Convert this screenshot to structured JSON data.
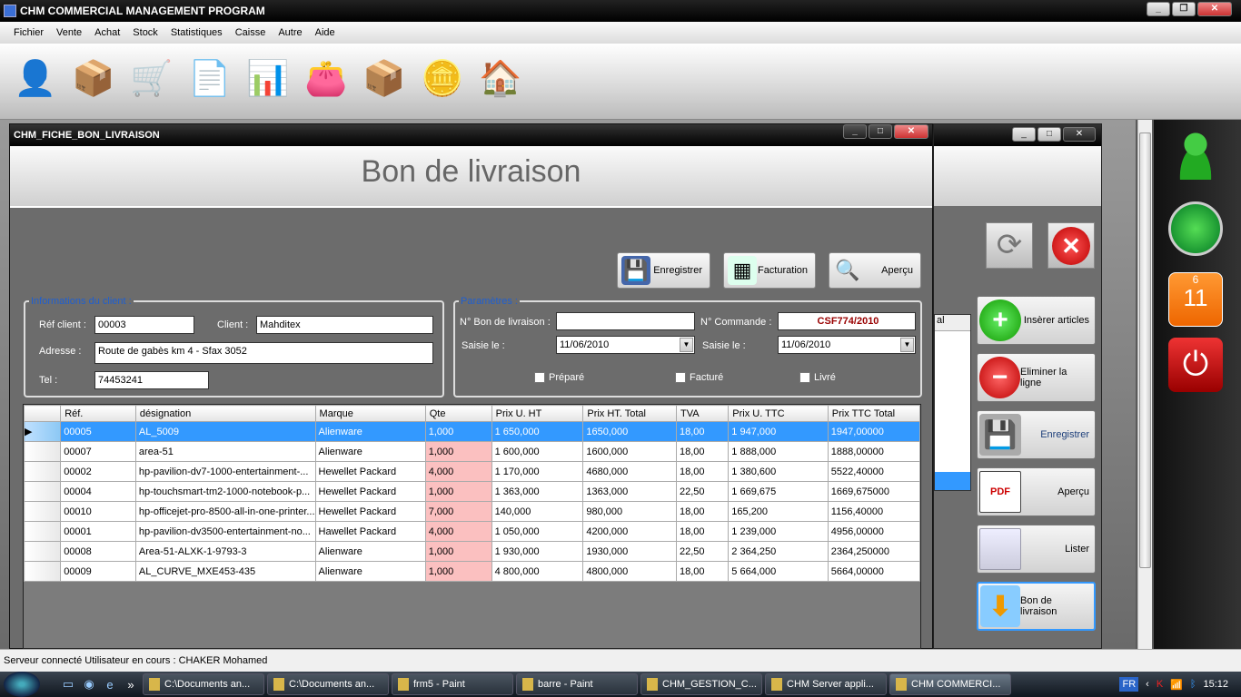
{
  "app": {
    "title": "CHM COMMERCIAL MANAGEMENT PROGRAM"
  },
  "menu": [
    "Fichier",
    "Vente",
    "Achat",
    "Stock",
    "Statistiques",
    "Caisse",
    "Autre",
    "Aide"
  ],
  "toolbar": [
    "user-icon",
    "products-icon",
    "cart-icon",
    "invoice-icon",
    "spreadsheet-icon",
    "wallet-icon",
    "box-icon",
    "coins-icon",
    "home-icon"
  ],
  "child": {
    "title": "CHM_FICHE_BON_LIVRAISON",
    "header": "Bon de livraison",
    "buttons": {
      "save": "Enregistrer",
      "billing": "Facturation",
      "preview": "Aperçu"
    },
    "client": {
      "legend": "Informations du client :",
      "ref_label": "Réf client :",
      "ref": "00003",
      "client_label": "Client :",
      "client": "Mahditex",
      "address_label": "Adresse :",
      "address": "Route de gabès km 4 - Sfax 3052",
      "tel_label": "Tel :",
      "tel": "74453241"
    },
    "params": {
      "legend": "Paramètres :",
      "bl_label": "N° Bon de livraison :",
      "bl": "",
      "cmd_label": "N° Commande :",
      "cmd": "CSF774/2010",
      "date1_label": "Saisie le :",
      "date1": "11/06/2010",
      "date2_label": "Saisie le :",
      "date2": "11/06/2010",
      "prepared": "Préparé",
      "billed": "Facturé",
      "delivered": "Livré"
    },
    "grid": {
      "columns": [
        "Réf.",
        "désignation",
        "Marque",
        "Qte",
        "Prix U. HT",
        "Prix HT. Total",
        "TVA",
        "Prix U. TTC",
        "Prix TTC Total"
      ],
      "rows": [
        [
          "00005",
          "AL_5009",
          "Alienware",
          "1,000",
          "1 650,000",
          "1650,000",
          "18,00",
          "1 947,000",
          "1947,00000"
        ],
        [
          "00007",
          "area-51",
          "Alienware",
          "1,000",
          "1 600,000",
          "1600,000",
          "18,00",
          "1 888,000",
          "1888,00000"
        ],
        [
          "00002",
          "hp-pavilion-dv7-1000-entertainment-...",
          "Hewellet Packard",
          "4,000",
          "1 170,000",
          "4680,000",
          "18,00",
          "1 380,600",
          "5522,40000"
        ],
        [
          "00004",
          "hp-touchsmart-tm2-1000-notebook-p...",
          "Hewellet Packard",
          "1,000",
          "1 363,000",
          "1363,000",
          "22,50",
          "1 669,675",
          "1669,675000"
        ],
        [
          "00010",
          "hp-officejet-pro-8500-all-in-one-printer...",
          "Hewellet Packard",
          "7,000",
          "140,000",
          "980,000",
          "18,00",
          "165,200",
          "1156,40000"
        ],
        [
          "00001",
          "hp-pavilion-dv3500-entertainment-no...",
          "Hawellet Packard",
          "4,000",
          "1 050,000",
          "4200,000",
          "18,00",
          "1 239,000",
          "4956,00000"
        ],
        [
          "00008",
          "Area-51-ALXK-1-9793-3",
          "Alienware",
          "1,000",
          "1 930,000",
          "1930,000",
          "22,50",
          "2 364,250",
          "2364,250000"
        ],
        [
          "00009",
          "AL_CURVE_MXE453-435",
          "Alienware",
          "1,000",
          "4 800,000",
          "4800,000",
          "18,00",
          "5 664,000",
          "5664,00000"
        ]
      ]
    }
  },
  "side": {
    "grid_header": "al",
    "insert": "Insèrer articles",
    "remove": "Eliminer la ligne",
    "save": "Enregistrer",
    "preview": "Aperçu",
    "list": "Lister",
    "delivery": "Bon de livraison"
  },
  "calendar": {
    "month": "6",
    "day": "11"
  },
  "status": "Serveur connecté   Utilisateur en cours : CHAKER Mohamed",
  "taskbar": {
    "tasks": [
      "C:\\Documents an...",
      "C:\\Documents an...",
      "frm5 - Paint",
      "barre - Paint",
      "CHM_GESTION_C...",
      "CHM Server appli...",
      "CHM COMMERCI..."
    ],
    "lang": "FR",
    "time": "15:12"
  }
}
